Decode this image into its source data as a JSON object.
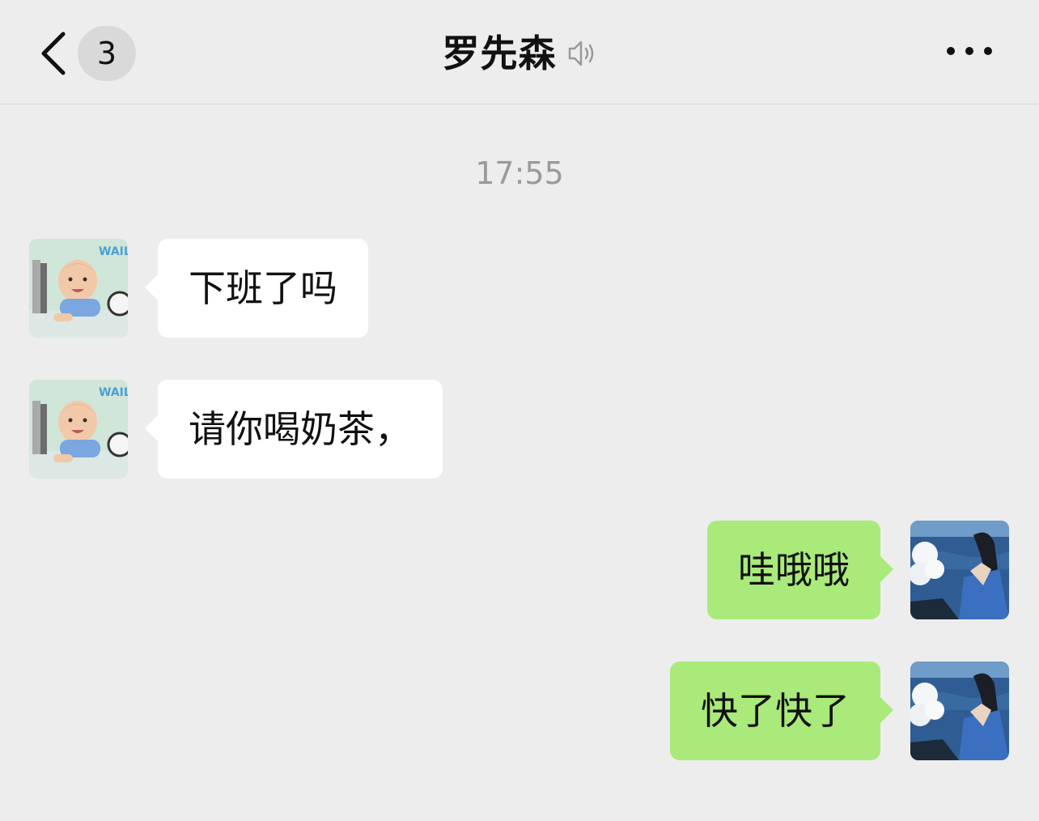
{
  "header": {
    "unread_count": "3",
    "title": "罗先森",
    "back_icon": "chevron-left-icon",
    "mute_icon": "mute-icon",
    "more_icon": "more-icon"
  },
  "timestamp": "17:55",
  "messages": [
    {
      "from": "contact",
      "text": "下班了吗"
    },
    {
      "from": "contact",
      "text": "请你喝奶茶，"
    },
    {
      "from": "me",
      "text": "哇哦哦"
    },
    {
      "from": "me",
      "text": "快了快了"
    }
  ],
  "colors": {
    "background": "#ededed",
    "incoming_bubble": "#ffffff",
    "outgoing_bubble": "#a9ea7a",
    "timestamp": "#9a9a9a"
  }
}
